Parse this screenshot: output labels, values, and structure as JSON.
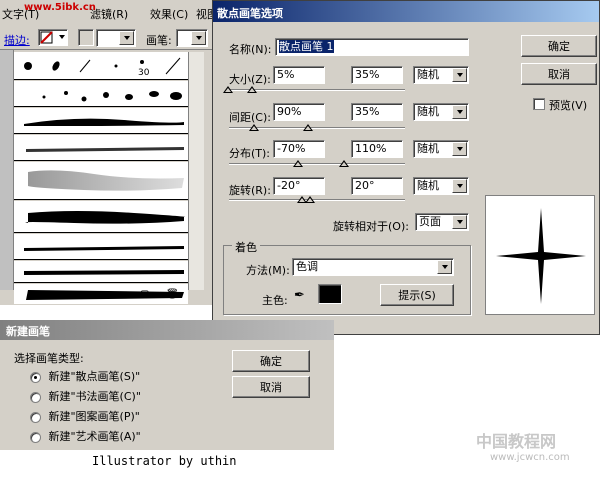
{
  "menubar": {
    "items": [
      "文字(T)",
      "滤镜(R)",
      "效果(C)",
      "视图"
    ],
    "watermark": "www.5ibk.cn"
  },
  "brush_toolbar": {
    "stroke_label": "描边:",
    "brush_label": "画笔:"
  },
  "brush_palette": {
    "preset_size_label": "30"
  },
  "scatter_dialog": {
    "title": "散点画笔选项",
    "name_label": "名称(N):",
    "name_value": "散点画笔 1",
    "ok_button": "确定",
    "cancel_button": "取消",
    "preview_label": "预览(V)",
    "rows": [
      {
        "label": "大小(Z):",
        "value1": "5%",
        "value2": "35%",
        "mode": "随机"
      },
      {
        "label": "间距(C):",
        "value1": "90%",
        "value2": "35%",
        "mode": "随机"
      },
      {
        "label": "分布(T):",
        "value1": "-70%",
        "value2": "110%",
        "mode": "随机"
      },
      {
        "label": "旋转(R):",
        "value1": "-20°",
        "value2": "20°",
        "mode": "随机"
      }
    ],
    "rotation_relative_label": "旋转相对于(O):",
    "rotation_relative_value": "页面",
    "coloring": {
      "group_title": "着色",
      "method_label": "方法(M):",
      "method_value": "色调",
      "key_color_label": "主色:",
      "tips_button": "提示(S)",
      "key_color": "#000000"
    }
  },
  "new_brush_dialog": {
    "title": "新建画笔",
    "prompt": "选择画笔类型:",
    "options": [
      {
        "label": "新建\"散点画笔(S)\"",
        "selected": true
      },
      {
        "label": "新建\"书法画笔(C)\"",
        "selected": false
      },
      {
        "label": "新建\"图案画笔(P)\"",
        "selected": false
      },
      {
        "label": "新建\"艺术画笔(A)\"",
        "selected": false
      }
    ],
    "ok_button": "确定",
    "cancel_button": "取消"
  },
  "footer": {
    "credit": "Illustrator by uthin",
    "watermark_title": "中国教程网",
    "watermark_url": "www.jcwcn.com"
  },
  "colors": {
    "dialog_bg": "#d4d0c8",
    "title_bar": "#0a246a",
    "watermark_red": "#cc0000"
  }
}
